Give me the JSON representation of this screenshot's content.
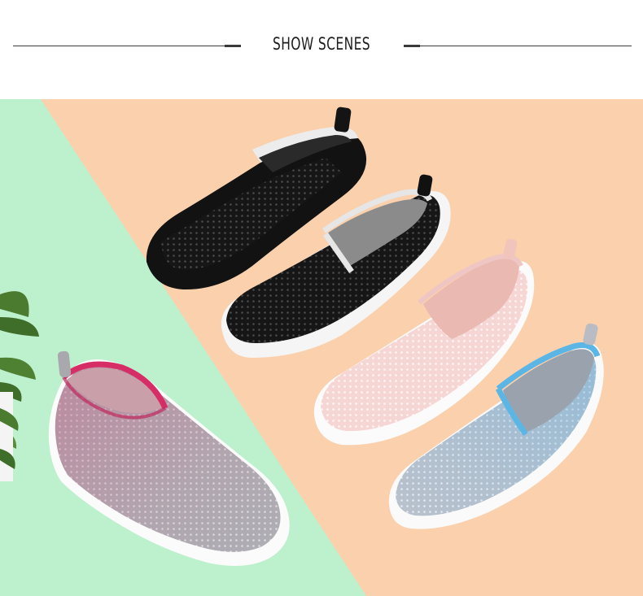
{
  "header": {
    "title": "SHOW SCENES"
  },
  "scene": {
    "background_colors": {
      "green": "#bdf0cd",
      "peach": "#fbd0ad",
      "white_tile": "#f7f7f7"
    },
    "shoes": [
      {
        "name": "black",
        "upper": "#141414",
        "trim": "#ffffff",
        "sole": "#1a1a1a"
      },
      {
        "name": "black-white-sole",
        "upper": "#161616",
        "trim": "#f2f2f2",
        "sole": "#f5f5f5"
      },
      {
        "name": "pink",
        "upper": "#f5d2d0",
        "trim": "#ecbcbc",
        "sole": "#fbfbfb"
      },
      {
        "name": "grey-blue",
        "upper": "#b5bcc6",
        "trim": "#5bb6e6",
        "sole": "#fafafa"
      },
      {
        "name": "grey-rose",
        "upper": "#a9a9ab",
        "trim": "#d62d66",
        "sole": "#fbfbfb"
      }
    ]
  }
}
